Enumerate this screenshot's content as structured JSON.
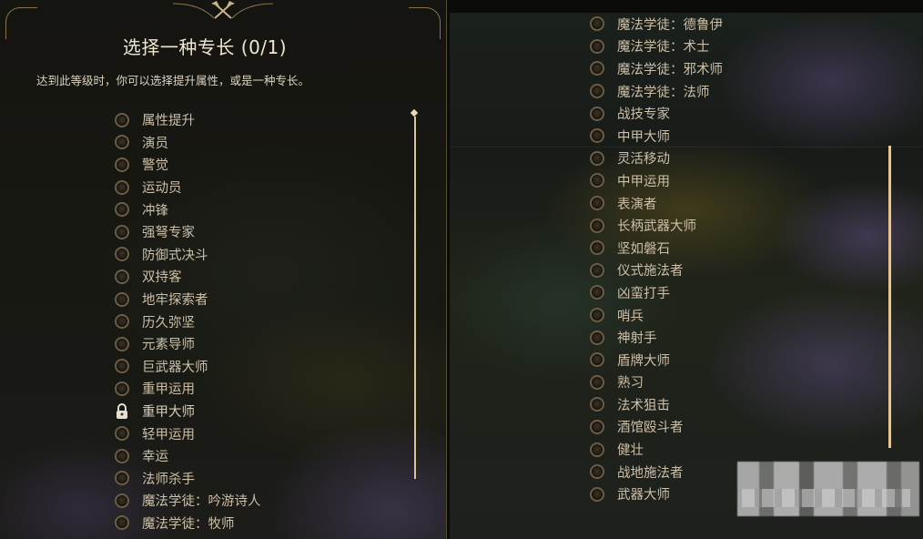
{
  "dialog": {
    "title": "选择一种专长 (0/1)",
    "subtitle": "达到此等级时，你可以选择提升属性，或是一种专长。"
  },
  "left_options": [
    {
      "label": "属性提升",
      "state": "unselected"
    },
    {
      "label": "演员",
      "state": "unselected"
    },
    {
      "label": "警觉",
      "state": "unselected"
    },
    {
      "label": "运动员",
      "state": "unselected"
    },
    {
      "label": "冲锋",
      "state": "unselected"
    },
    {
      "label": "强弩专家",
      "state": "unselected"
    },
    {
      "label": "防御式决斗",
      "state": "unselected"
    },
    {
      "label": "双持客",
      "state": "unselected"
    },
    {
      "label": "地牢探索者",
      "state": "unselected"
    },
    {
      "label": "历久弥坚",
      "state": "unselected"
    },
    {
      "label": "元素导师",
      "state": "unselected"
    },
    {
      "label": "巨武器大师",
      "state": "unselected"
    },
    {
      "label": "重甲运用",
      "state": "unselected"
    },
    {
      "label": "重甲大师",
      "state": "locked"
    },
    {
      "label": "轻甲运用",
      "state": "unselected"
    },
    {
      "label": "幸运",
      "state": "unselected"
    },
    {
      "label": "法师杀手",
      "state": "unselected"
    },
    {
      "label": "魔法学徒：吟游诗人",
      "state": "unselected"
    },
    {
      "label": "魔法学徒：牧师",
      "state": "unselected"
    }
  ],
  "right_options": [
    {
      "label": "魔法学徒：德鲁伊",
      "state": "unselected"
    },
    {
      "label": "魔法学徒：术士",
      "state": "unselected"
    },
    {
      "label": "魔法学徒：邪术师",
      "state": "unselected"
    },
    {
      "label": "魔法学徒：法师",
      "state": "unselected"
    },
    {
      "label": "战技专家",
      "state": "unselected"
    },
    {
      "label": "中甲大师",
      "state": "unselected"
    },
    {
      "label": "灵活移动",
      "state": "unselected"
    },
    {
      "label": "中甲运用",
      "state": "unselected"
    },
    {
      "label": "表演者",
      "state": "unselected"
    },
    {
      "label": "长柄武器大师",
      "state": "unselected"
    },
    {
      "label": "坚如磐石",
      "state": "unselected"
    },
    {
      "label": "仪式施法者",
      "state": "unselected"
    },
    {
      "label": "凶蛮打手",
      "state": "unselected"
    },
    {
      "label": "哨兵",
      "state": "unselected"
    },
    {
      "label": "神射手",
      "state": "unselected"
    },
    {
      "label": "盾牌大师",
      "state": "unselected"
    },
    {
      "label": "熟习",
      "state": "unselected"
    },
    {
      "label": "法术狙击",
      "state": "unselected"
    },
    {
      "label": "酒馆殴斗者",
      "state": "unselected"
    },
    {
      "label": "健壮",
      "state": "unselected"
    },
    {
      "label": "战地施法者",
      "state": "unselected"
    },
    {
      "label": "武器大师",
      "state": "unselected"
    }
  ],
  "icons": {
    "crest": "crossed-axes-icon",
    "radio": "radio-circle-icon",
    "locked": "padlock-icon"
  },
  "colors": {
    "accent": "#e1c79b",
    "label_text": "#cdbfa8",
    "title_text": "#efe6d2"
  }
}
